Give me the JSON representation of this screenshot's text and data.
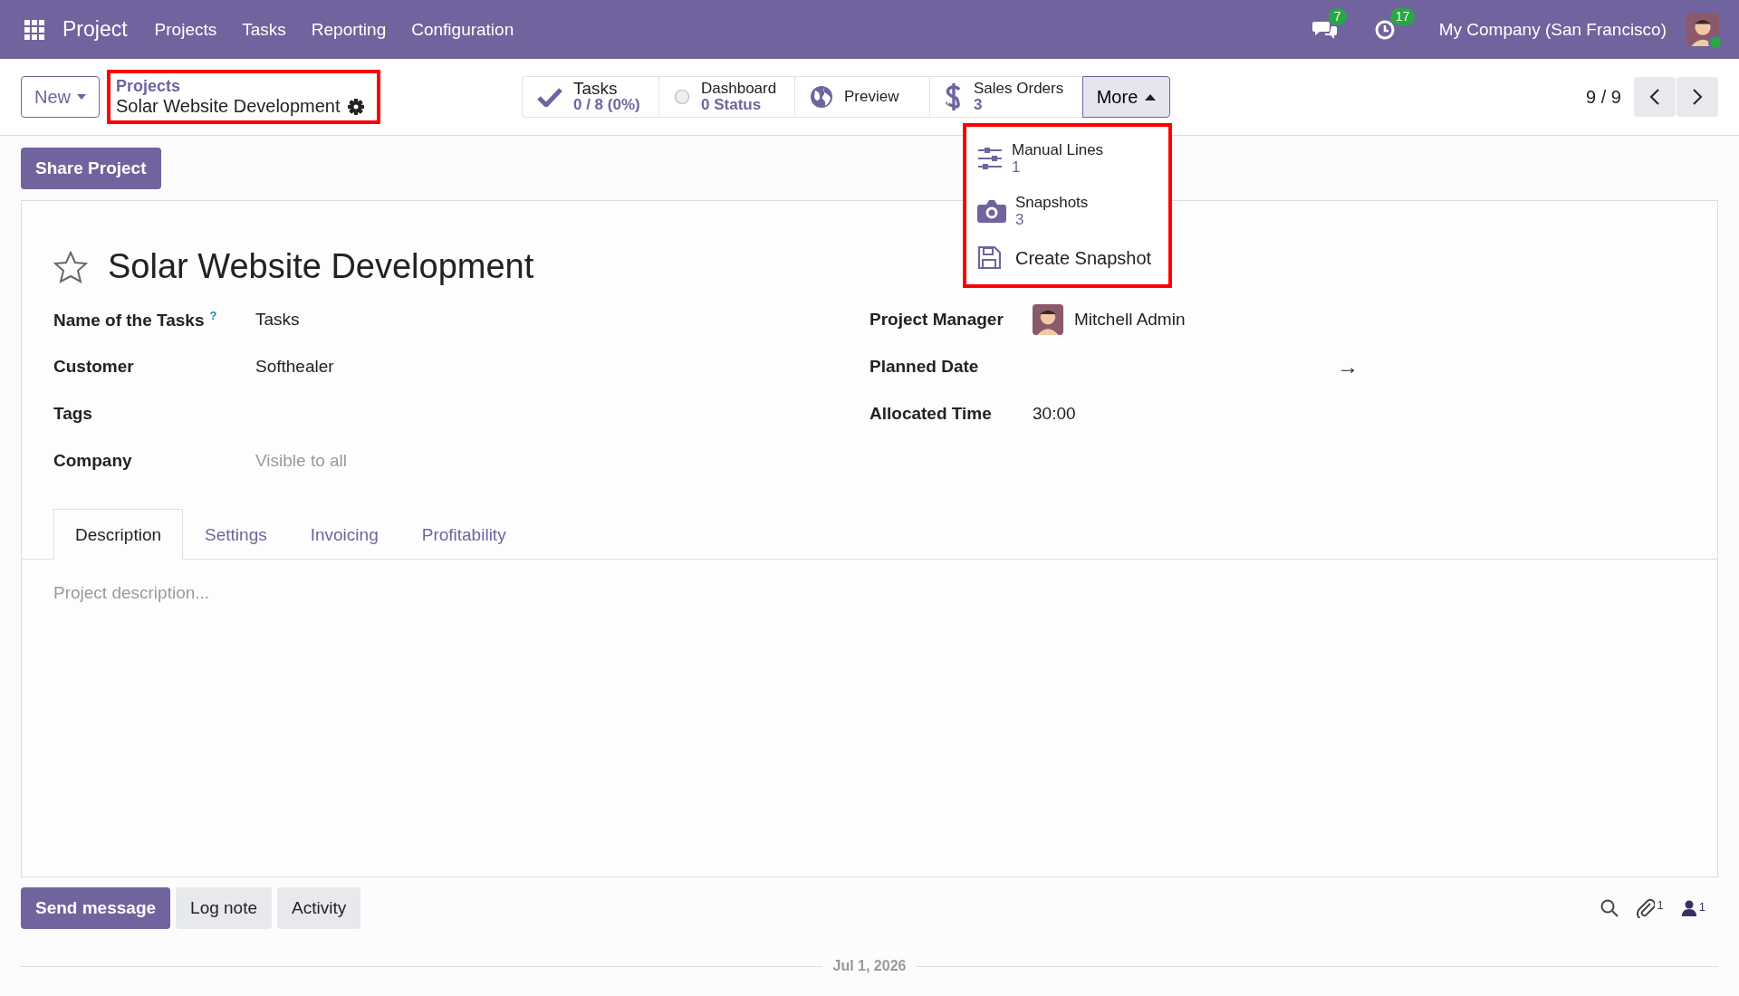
{
  "navbar": {
    "app": "Project",
    "menu": [
      "Projects",
      "Tasks",
      "Reporting",
      "Configuration"
    ],
    "messages_badge": "7",
    "activities_badge": "17",
    "company": "My Company (San Francisco)"
  },
  "control_panel": {
    "new_button": "New",
    "breadcrumb": {
      "parent": "Projects",
      "current": "Solar Website Development"
    },
    "smart_buttons": [
      {
        "kind": "tasks",
        "label": "Tasks",
        "value": "0 / 8 (0%)"
      },
      {
        "kind": "dashboard",
        "label": "Dashboard",
        "value": "0 Status"
      },
      {
        "kind": "preview",
        "label": "Preview"
      },
      {
        "kind": "sales",
        "label": "Sales Orders",
        "value": "3"
      }
    ],
    "more": {
      "label": "More",
      "expanded": true,
      "items": [
        {
          "kind": "lines",
          "label": "Manual Lines",
          "value": "1"
        },
        {
          "kind": "snapshots",
          "label": "Snapshots",
          "value": "3"
        },
        {
          "kind": "create",
          "label": "Create Snapshot"
        }
      ]
    },
    "pager": "9 / 9"
  },
  "share_button": "Share Project",
  "form": {
    "starred": false,
    "title": "Solar Website Development",
    "left_fields": [
      {
        "label": "Name of the Tasks",
        "help": "?",
        "value": "Tasks"
      },
      {
        "label": "Customer",
        "value": "Softhealer"
      },
      {
        "label": "Tags"
      },
      {
        "label": "Company",
        "placeholder": "Visible to all"
      }
    ],
    "right_fields": [
      {
        "kind": "user",
        "label": "Project Manager",
        "value": "Mitchell Admin"
      },
      {
        "kind": "daterange",
        "label": "Planned Date",
        "arrow": "→"
      },
      {
        "kind": "text",
        "label": "Allocated Time",
        "value": "30:00"
      }
    ],
    "tabs": [
      {
        "label": "Description",
        "selected": true
      },
      {
        "label": "Settings",
        "selected": false
      },
      {
        "label": "Invoicing",
        "selected": false
      },
      {
        "label": "Profitability",
        "selected": false
      }
    ],
    "description": {
      "placeholder": "Project description..."
    }
  },
  "chatter": {
    "buttons": [
      {
        "label": "Send message",
        "selected": true
      },
      {
        "label": "Log note",
        "selected": false
      },
      {
        "label": "Activity",
        "selected": false
      }
    ],
    "attachments_count": "1",
    "followers_count": "1",
    "date": "Jul 1, 2026"
  }
}
